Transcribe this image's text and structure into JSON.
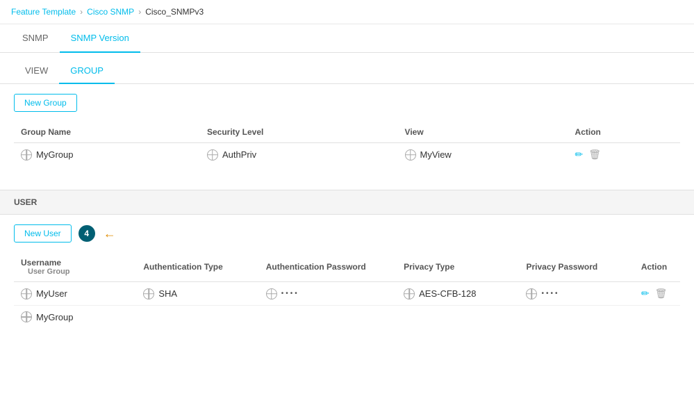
{
  "breadcrumb": {
    "items": [
      "Feature Template",
      "Cisco SNMP",
      "Cisco_SNMPv3"
    ]
  },
  "mainTabs": {
    "tabs": [
      "SNMP",
      "SNMP Version"
    ],
    "active": 1
  },
  "subTabs": {
    "tabs": [
      "VIEW",
      "GROUP"
    ],
    "active": 1
  },
  "newGroupButton": "New Group",
  "groupTable": {
    "columns": [
      "Group Name",
      "Security Level",
      "View",
      "Action"
    ],
    "rows": [
      {
        "groupName": "MyGroup",
        "securityLevel": "AuthPriv",
        "view": "MyView"
      }
    ]
  },
  "userSectionLabel": "USER",
  "newUserButton": "New User",
  "stepBadge": "4",
  "userTable": {
    "columns": [
      "Username",
      "Authentication Type",
      "Authentication Password",
      "Privacy Type",
      "Privacy Password",
      "Action"
    ],
    "subColumns": [
      "User Group"
    ],
    "rows": [
      {
        "username": "MyUser",
        "authType": "SHA",
        "authPass": "••••",
        "privType": "AES-CFB-128",
        "privPass": "••••",
        "userGroup": "MyGroup"
      }
    ]
  },
  "icons": {
    "edit": "✏",
    "delete": "🗑",
    "arrow": "←"
  }
}
